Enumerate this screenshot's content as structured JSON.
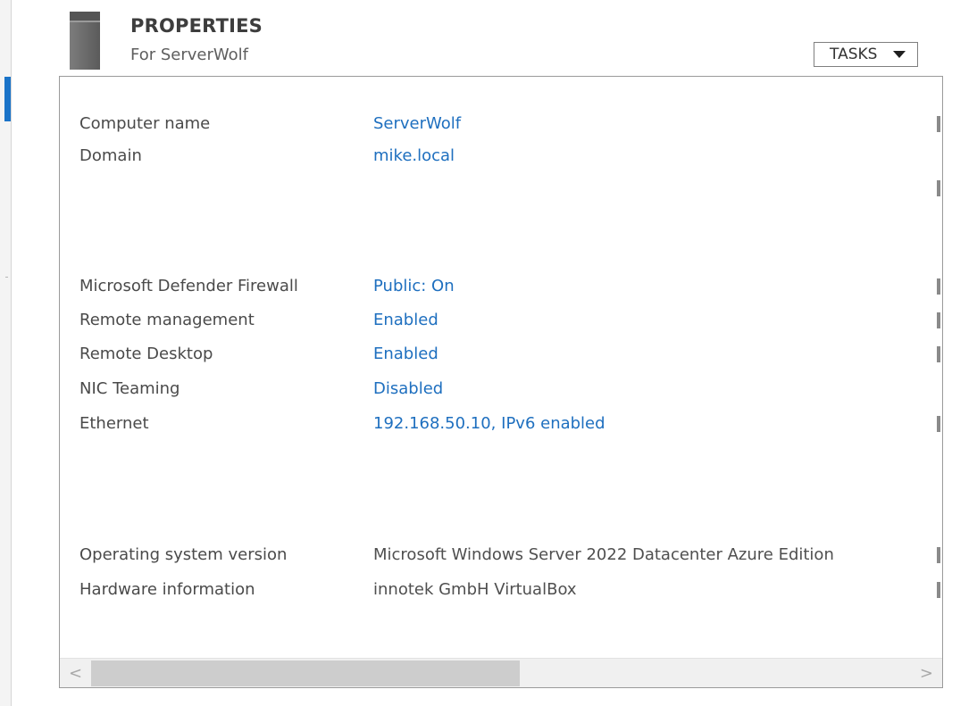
{
  "tile": {
    "title": "PROPERTIES",
    "subtitle": "For ServerWolf",
    "tasks_label": "TASKS",
    "icon": "server-icon"
  },
  "properties": {
    "computer_name": {
      "label": "Computer name",
      "value": "ServerWolf"
    },
    "domain": {
      "label": "Domain",
      "value": "mike.local"
    },
    "firewall": {
      "label": "Microsoft Defender Firewall",
      "value": "Public: On"
    },
    "remote_management": {
      "label": "Remote management",
      "value": "Enabled"
    },
    "remote_desktop": {
      "label": "Remote Desktop",
      "value": "Enabled"
    },
    "nic_teaming": {
      "label": "NIC Teaming",
      "value": "Disabled"
    },
    "ethernet": {
      "label": "Ethernet",
      "value": "192.168.50.10, IPv6 enabled"
    },
    "os_version": {
      "label": "Operating system version",
      "value": "Microsoft Windows Server 2022 Datacenter Azure Edition"
    },
    "hardware": {
      "label": "Hardware information",
      "value": "innotek GmbH VirtualBox"
    }
  },
  "scrollbar": {
    "left_arrow": "<",
    "right_arrow": ">",
    "position": 0
  },
  "colors": {
    "link": "#1e6fbf",
    "accent": "#1a73c8",
    "label": "#4a4a4a"
  }
}
